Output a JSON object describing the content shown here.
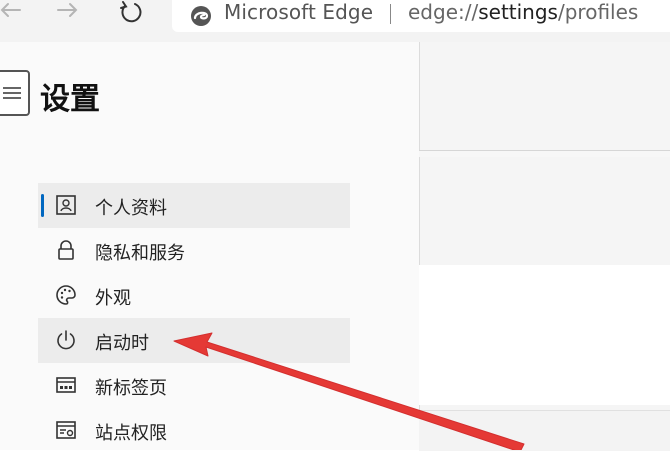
{
  "browser": {
    "site_name": "Microsoft Edge",
    "url_scheme": "edge://",
    "url_host": "settings",
    "url_path": "/profiles"
  },
  "settings": {
    "title": "设置",
    "nav_items": [
      {
        "label": "个人资料",
        "icon": "profile-icon",
        "state": "active"
      },
      {
        "label": "隐私和服务",
        "icon": "lock-icon",
        "state": "normal"
      },
      {
        "label": "外观",
        "icon": "palette-icon",
        "state": "normal"
      },
      {
        "label": "启动时",
        "icon": "power-icon",
        "state": "hover"
      },
      {
        "label": "新标签页",
        "icon": "new-tab-icon",
        "state": "normal"
      },
      {
        "label": "站点权限",
        "icon": "site-permissions-icon",
        "state": "normal"
      }
    ]
  },
  "annotation": {
    "type": "arrow",
    "color": "#e53935",
    "points_to": "启动时"
  },
  "colors": {
    "accent": "#0067c0",
    "sidebar_bg": "#fafafa",
    "selected_bg": "#ececec"
  }
}
